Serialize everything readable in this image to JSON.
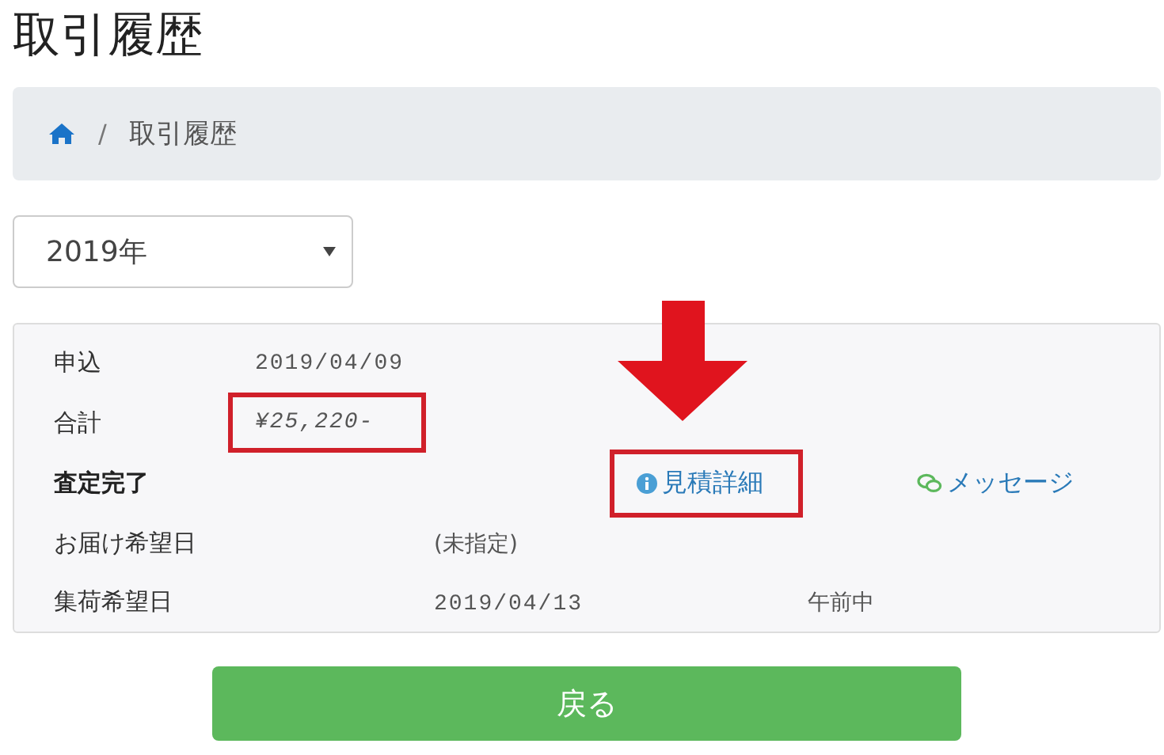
{
  "title": "取引履歴",
  "breadcrumb": {
    "separator": "/",
    "current": "取引履歴"
  },
  "year_select": {
    "value": "2019年"
  },
  "record": {
    "rows": [
      {
        "kind": "value",
        "label": "申込",
        "value": "2019/04/09",
        "highlighted": false
      },
      {
        "kind": "value",
        "label": "合計",
        "value": "¥25,220-",
        "highlighted": true
      },
      {
        "kind": "status",
        "label": "査定完了",
        "estimate_link": {
          "label": "見積詳細",
          "highlighted": true,
          "arrow": true
        },
        "message_link": {
          "label": "メッセージ"
        }
      },
      {
        "kind": "wide",
        "label": "お届け希望日",
        "value": "(未指定)"
      },
      {
        "kind": "wide",
        "label": "集荷希望日",
        "value": "2019/04/13",
        "extra": "午前中"
      }
    ]
  },
  "back_button": {
    "label": "戻る"
  }
}
